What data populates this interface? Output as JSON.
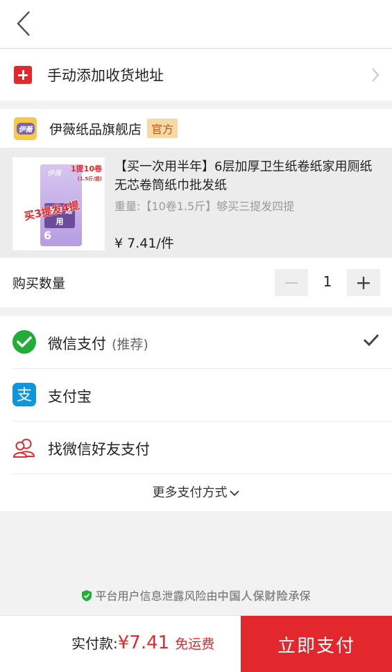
{
  "address": {
    "label": "手动添加收货地址"
  },
  "shop": {
    "logo_text": "伊薇",
    "name": "伊薇纸品旗舰店",
    "badge": "官方"
  },
  "product": {
    "title": "【买一次用半年】6层加厚卫生纸卷纸家用厕纸无芯卷筒纸巾批发纸",
    "spec": "重量:【10卷1.5斤】够买三提发四提",
    "price": "¥ 7.41/件",
    "image": {
      "brand": "伊薇",
      "pack_text": "母婴 适用",
      "layers": "6",
      "promo_top": "1提10卷",
      "promo_weight": "(1.5斤/提)",
      "promo_band": "买3提发4提"
    }
  },
  "quantity": {
    "label": "购买数量",
    "value": "1"
  },
  "payment": {
    "wechat": {
      "label": "微信支付",
      "note": "(推荐)",
      "selected": true
    },
    "alipay": {
      "label": "支付宝"
    },
    "friend": {
      "label": "找微信好友支付"
    },
    "more": "更多支付方式"
  },
  "insurance": {
    "prefix": "平台用户信息泄露风险由",
    "insurer": "中国人保财险",
    "suffix": "承保"
  },
  "footer": {
    "total_label": "实付款:",
    "total_amount": "¥7.41",
    "shipping": "免运费",
    "pay_button": "立即支付"
  },
  "colors": {
    "accent": "#e2282d",
    "wechat": "#22ac38",
    "alipay": "#1296db",
    "badge_bg": "#f6d9a4"
  }
}
